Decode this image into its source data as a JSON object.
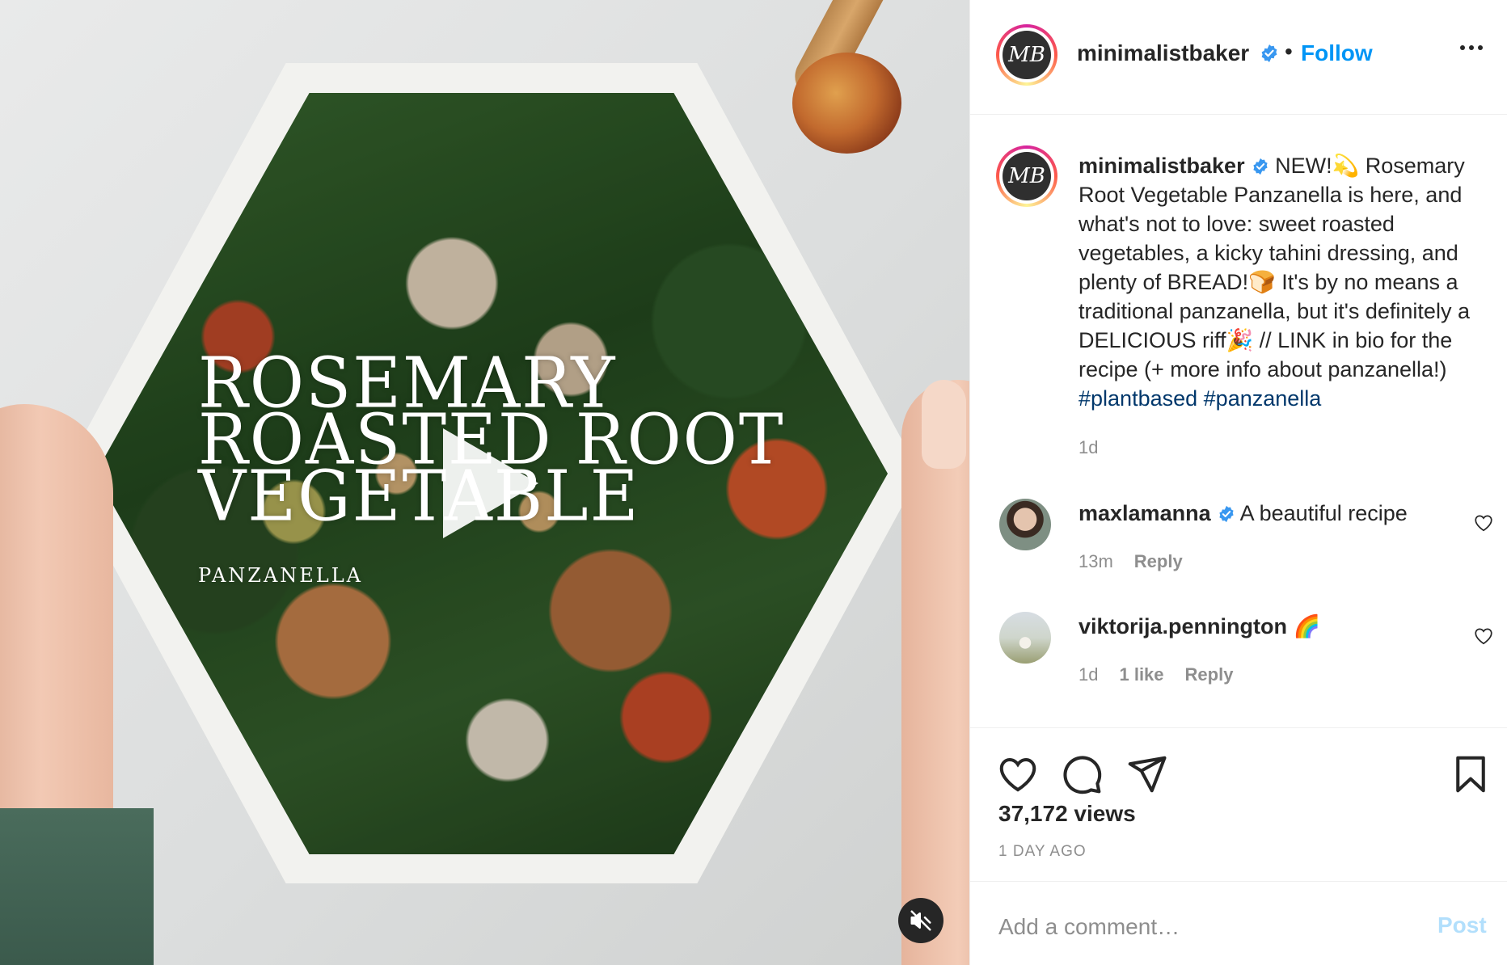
{
  "media": {
    "overlay_title_lines": [
      "ROSEMARY",
      "ROASTED ROOT",
      "VEGETABLE"
    ],
    "overlay_subtitle": "PANZANELLA"
  },
  "header": {
    "avatar_monogram": "MB",
    "username": "minimalistbaker",
    "separator": "•",
    "follow_label": "Follow"
  },
  "caption": {
    "username": "minimalistbaker",
    "avatar_monogram": "MB",
    "text_1": "NEW!💫 Rosemary Root Vegetable Panzanella is here, and what's not to love: sweet roasted vegetables, a kicky tahini dressing, and plenty of BREAD!🍞 It's by no means a traditional panzanella, but it's definitely a DELICIOUS riff🎉 // LINK in bio for the recipe (+ more info about panzanella!)",
    "hashtag_1": "#plantbased",
    "hashtag_2": "#panzanella",
    "time": "1d"
  },
  "comments": [
    {
      "username": "maxlamanna",
      "text": "A beautiful recipe",
      "time": "13m",
      "likes": "",
      "reply_label": "Reply"
    },
    {
      "username": "viktorija.pennington",
      "text": "🌈",
      "time": "1d",
      "likes": "1 like",
      "reply_label": "Reply"
    }
  ],
  "actions": {
    "views": "37,172 views",
    "date": "1 DAY AGO"
  },
  "add_comment": {
    "placeholder": "Add a comment…",
    "post_label": "Post"
  },
  "colors": {
    "link_blue": "#0095f6",
    "hashtag": "#00376b",
    "muted": "#8e8e8e",
    "post_disabled": "#b2dffc",
    "verified": "#3897f0"
  }
}
